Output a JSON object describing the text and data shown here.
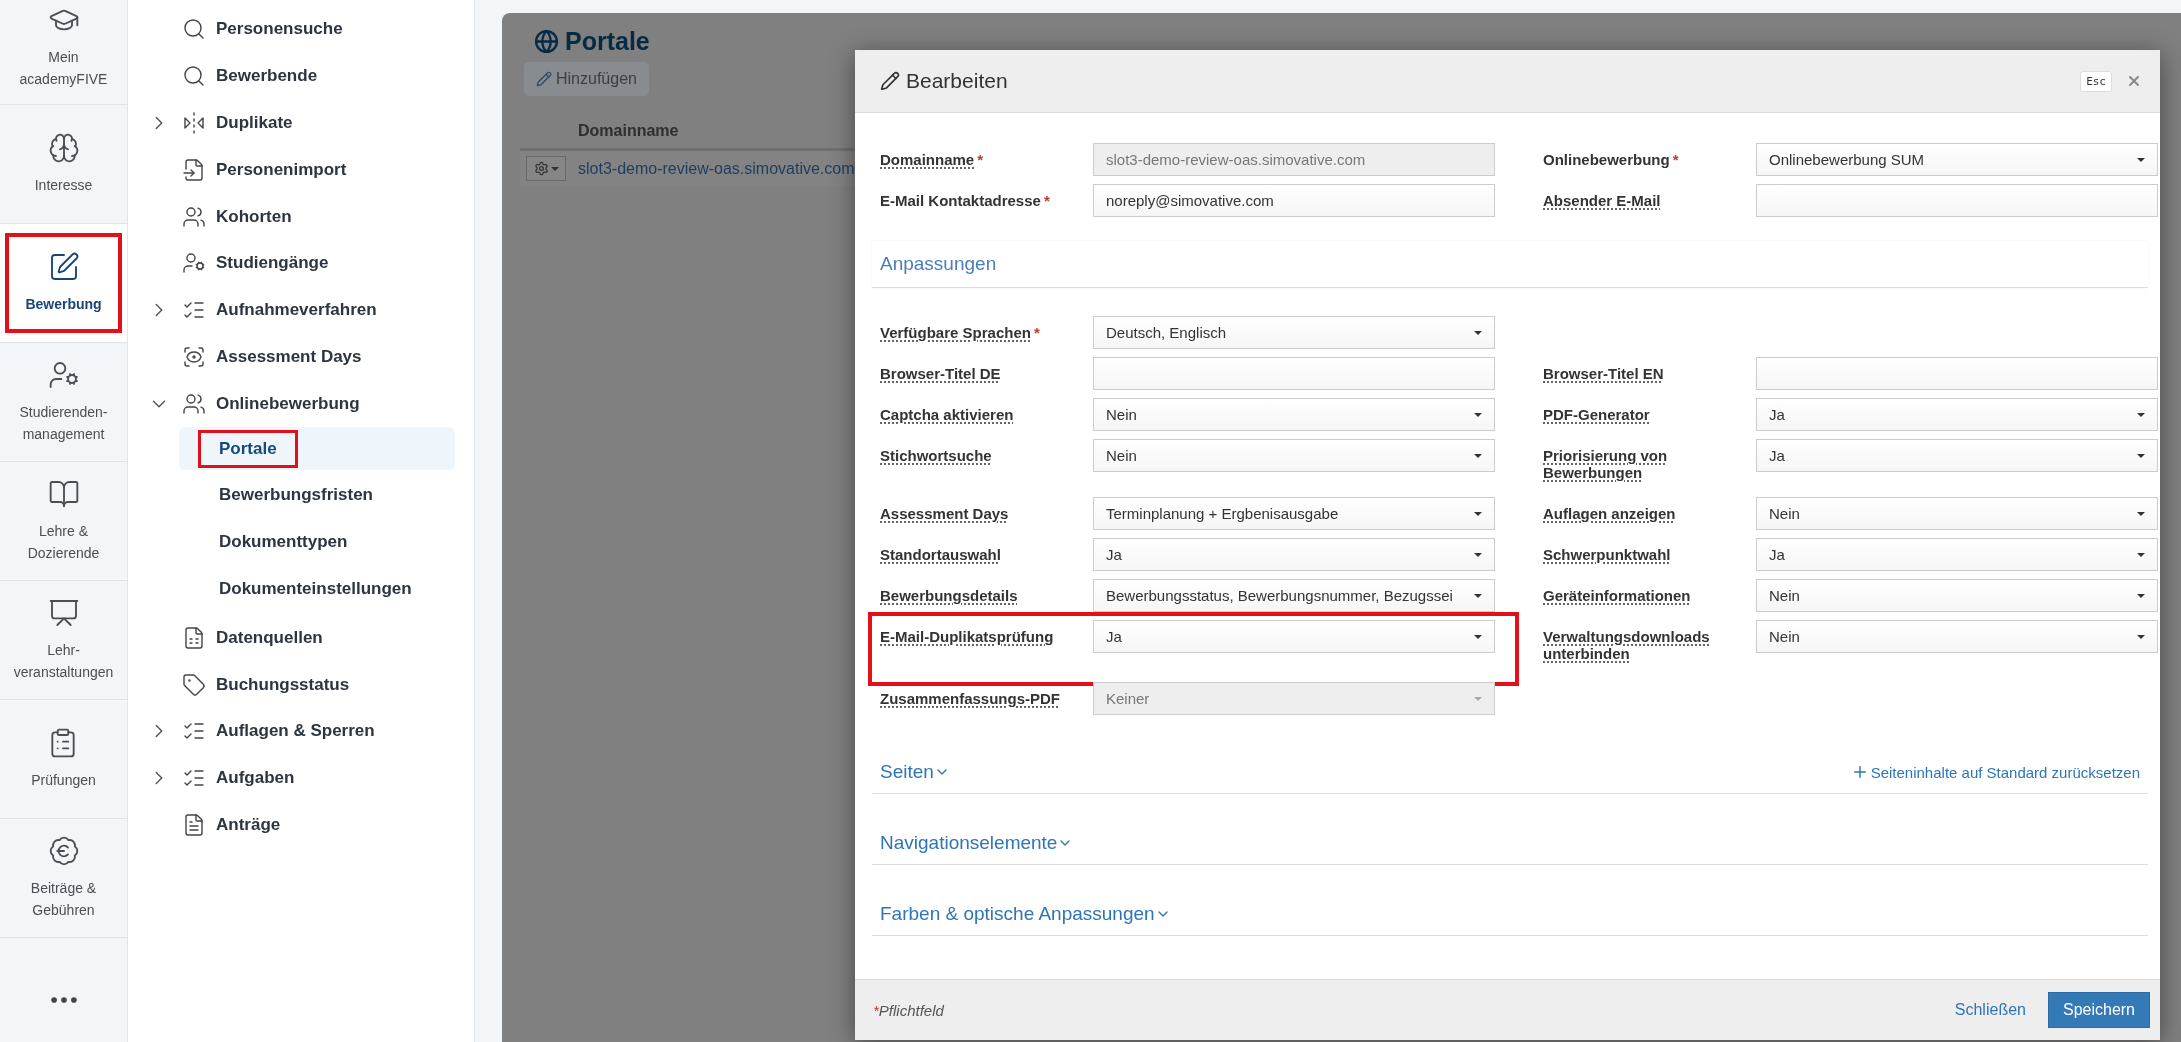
{
  "rail": [
    {
      "label": "Mein academyFIVE",
      "selected": false,
      "highlighted": false
    },
    {
      "label": "Interesse",
      "selected": false,
      "highlighted": false
    },
    {
      "label": "Bewerbung",
      "selected": true,
      "highlighted": true
    },
    {
      "label": "Studierenden-management",
      "selected": false,
      "highlighted": false
    },
    {
      "label": "Lehre & Dozierende",
      "selected": false,
      "highlighted": false
    },
    {
      "label": "Lehr-veranstaltungen",
      "selected": false,
      "highlighted": false
    },
    {
      "label": "Prüfungen",
      "selected": false,
      "highlighted": false
    },
    {
      "label": "Beiträge & Gebühren",
      "selected": false,
      "highlighted": false
    }
  ],
  "sidebar": {
    "items": [
      {
        "label": "Personensuche"
      },
      {
        "label": "Bewerbende"
      },
      {
        "label": "Duplikate",
        "expanded": false
      },
      {
        "label": "Personenimport"
      },
      {
        "label": "Kohorten"
      },
      {
        "label": "Studiengänge"
      },
      {
        "label": "Aufnahmeverfahren",
        "expanded": false
      },
      {
        "label": "Assessment Days"
      },
      {
        "label": "Onlinebewerbung",
        "expanded": true,
        "children": [
          {
            "label": "Portale",
            "selected": true,
            "highlighted": true
          },
          {
            "label": "Bewerbungsfristen",
            "selected": false,
            "highlighted": false
          },
          {
            "label": "Dokumenttypen",
            "selected": false,
            "highlighted": false
          },
          {
            "label": "Dokumenteinstellungen",
            "selected": false,
            "highlighted": false
          }
        ]
      },
      {
        "label": "Datenquellen"
      },
      {
        "label": "Buchungsstatus"
      },
      {
        "label": "Auflagen & Sperren",
        "expanded": false
      },
      {
        "label": "Aufgaben",
        "expanded": false
      },
      {
        "label": "Anträge"
      }
    ]
  },
  "page": {
    "title": "Portale",
    "add_button": "Hinzufügen",
    "table": {
      "columns": [
        "Domainname"
      ],
      "rows": [
        {
          "domain": "slot3-demo-review-oas.simovative.com"
        }
      ]
    }
  },
  "dialog": {
    "title": "Bearbeiten",
    "esc_hint": "Esc",
    "top_rows": [
      [
        {
          "label": "Domainname",
          "required_mark": "*",
          "kind": "text",
          "value": "slot3-demo-review-oas.simovative.com",
          "disabled": true,
          "dotted": true
        },
        {
          "label": "Onlinebewerbung",
          "required_mark": "*",
          "kind": "select",
          "value": "Onlinebewerbung SUM",
          "disabled": false,
          "dotted": false
        }
      ],
      [
        {
          "label": "E-Mail Kontaktadresse",
          "required_mark": "*",
          "kind": "text",
          "value": "noreply@simovative.com",
          "disabled": false,
          "dotted": false
        },
        {
          "label": "Absender E-Mail",
          "kind": "text",
          "disabled": false,
          "dotted": true
        }
      ]
    ],
    "section": "Anpassungen",
    "rows": [
      [
        {
          "label": "Verfügbare Sprachen",
          "required_mark": "*",
          "kind": "select",
          "value": "Deutsch, Englisch",
          "disabled": false,
          "dotted": true
        }
      ],
      [
        {
          "label": "Browser-Titel DE",
          "kind": "text",
          "disabled": false,
          "dotted": true
        },
        {
          "label": "Browser-Titel EN",
          "kind": "text",
          "disabled": false,
          "dotted": true
        }
      ],
      [
        {
          "label": "Captcha aktivieren",
          "kind": "select",
          "value": "Nein",
          "disabled": false,
          "dotted": true
        },
        {
          "label": "PDF-Generator",
          "kind": "select",
          "value": "Ja",
          "disabled": false,
          "dotted": true
        }
      ],
      [
        {
          "label": "Stichwortsuche",
          "kind": "select",
          "value": "Nein",
          "disabled": false,
          "dotted": true
        },
        {
          "label": "Priorisierung von Bewerbungen",
          "kind": "select",
          "value": "Ja",
          "disabled": false,
          "dotted": true
        }
      ],
      [
        {
          "label": "Assessment Days",
          "kind": "select",
          "value": "Terminplanung + Ergbenisausgabe",
          "disabled": false,
          "dotted": true
        },
        {
          "label": "Auflagen anzeigen",
          "kind": "select",
          "value": "Nein",
          "disabled": false,
          "dotted": true
        }
      ],
      [
        {
          "label": "Standortauswahl",
          "kind": "select",
          "value": "Ja",
          "disabled": false,
          "dotted": true
        },
        {
          "label": "Schwerpunktwahl",
          "kind": "select",
          "value": "Ja",
          "disabled": false,
          "dotted": true
        }
      ],
      [
        {
          "label": "Bewerbungsdetails",
          "kind": "select",
          "value": "Bewerbungsstatus, Bewerbungsnummer, Bezugssei",
          "disabled": false,
          "dotted": true
        },
        {
          "label": "Geräteinformationen",
          "kind": "select",
          "value": "Nein",
          "disabled": false,
          "dotted": true
        }
      ],
      [
        {
          "label": "E-Mail-Duplikatsprüfung",
          "kind": "select",
          "value": "Ja",
          "disabled": false,
          "dotted": true,
          "highlighted": true
        },
        {
          "label": "Verwaltungsdownloads unterbinden",
          "kind": "select",
          "value": "Nein",
          "disabled": false,
          "dotted": true
        }
      ],
      [
        {
          "label": "Zusammenfassungs-PDF",
          "kind": "select",
          "value": "Keiner",
          "disabled": true,
          "dotted": true
        }
      ]
    ],
    "collapsibles": [
      {
        "title": "Seiten",
        "expanded": false,
        "action": "Seiteninhalte auf Standard zurücksetzen"
      },
      {
        "title": "Navigationselemente",
        "expanded": false
      },
      {
        "title": "Farben & optische Anpassungen",
        "expanded": false
      }
    ],
    "footer": {
      "required_mark": "*",
      "note": "Pflichtfeld",
      "close": "Schließen",
      "save": "Speichern"
    }
  }
}
